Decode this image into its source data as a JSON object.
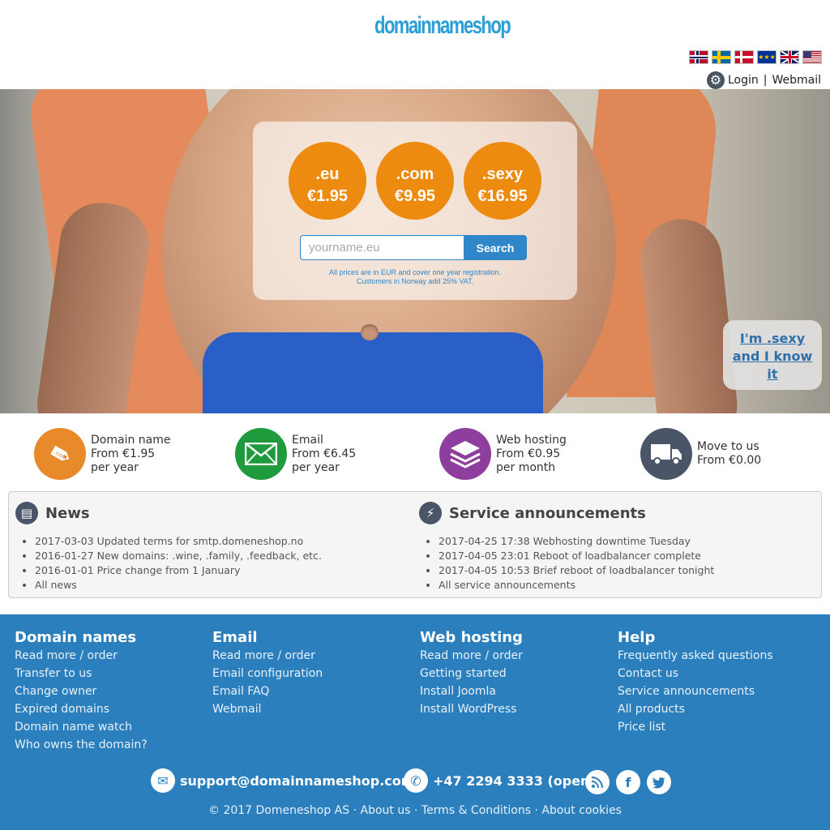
{
  "header": {
    "logo": "domainnameshop",
    "flags": [
      "Norway",
      "Sweden",
      "Denmark",
      "EU",
      "UK",
      "USA"
    ],
    "login": "Login",
    "separator": "|",
    "webmail": "Webmail"
  },
  "hero": {
    "tlds": [
      {
        "ext": ".eu",
        "price": "€1.95"
      },
      {
        "ext": ".com",
        "price": "€9.95"
      },
      {
        "ext": ".sexy",
        "price": "€16.95"
      }
    ],
    "search": {
      "placeholder": "yourname.eu",
      "button": "Search"
    },
    "note_line1": "All prices are in EUR and cover one year registration.",
    "note_line2": "Customers in Norway add 25% VAT.",
    "promo": {
      "line1": "I'm .sexy",
      "line2": "and I know",
      "line3": "it"
    }
  },
  "products": [
    {
      "icon": "tag-icon",
      "line1": "Domain name",
      "line2": "From €1.95",
      "line3": "per year"
    },
    {
      "icon": "envelope-icon",
      "line1": "Email",
      "line2": "From €6.45",
      "line3": "per year"
    },
    {
      "icon": "layers-icon",
      "line1": "Web hosting",
      "line2": "From €0.95",
      "line3": "per month"
    },
    {
      "icon": "truck-icon",
      "line1": "Move to us",
      "line2": "From €0.00",
      "line3": ""
    }
  ],
  "news": {
    "title": "News",
    "items": [
      "2017-03-03 Updated terms for smtp.domeneshop.no",
      "2016-01-27 New domains: .wine, .family, .feedback, etc.",
      "2016-01-01 Price change from 1 January",
      "All news"
    ]
  },
  "service": {
    "title": "Service announcements",
    "items": [
      "2017-04-25 17:38 Webhosting downtime Tuesday",
      "2017-04-05 23:01 Reboot of loadbalancer complete",
      "2017-04-05 10:53 Brief reboot of loadbalancer tonight",
      "All service announcements"
    ]
  },
  "footer": {
    "columns": [
      {
        "title": "Domain names",
        "links": [
          "Read more / order",
          "Transfer to us",
          "Change owner",
          "Expired domains",
          "Domain name watch",
          "Who owns the domain?"
        ]
      },
      {
        "title": "Email",
        "links": [
          "Read more / order",
          "Email configuration",
          "Email FAQ",
          "Webmail"
        ]
      },
      {
        "title": "Web hosting",
        "links": [
          "Read more / order",
          "Getting started",
          "Install Joomla",
          "Install WordPress"
        ]
      },
      {
        "title": "Help",
        "links": [
          "Frequently asked questions",
          "Contact us",
          "Service announcements",
          "All products",
          "Price list"
        ]
      }
    ],
    "email": "support@domainnameshop.com",
    "phone": "+47 2294 3333 (open)",
    "copyright": "© 2017 Domeneshop AS",
    "about": "About us",
    "terms": "Terms & Conditions",
    "cookies": "About cookies"
  },
  "colors": {
    "brand_blue": "#2b7fbd",
    "tld_orange": "#ed8b10",
    "domain_icon": "#e8892a",
    "email_icon": "#1f9a3c",
    "hosting_icon": "#8e3e9c",
    "move_icon": "#4a5568"
  }
}
